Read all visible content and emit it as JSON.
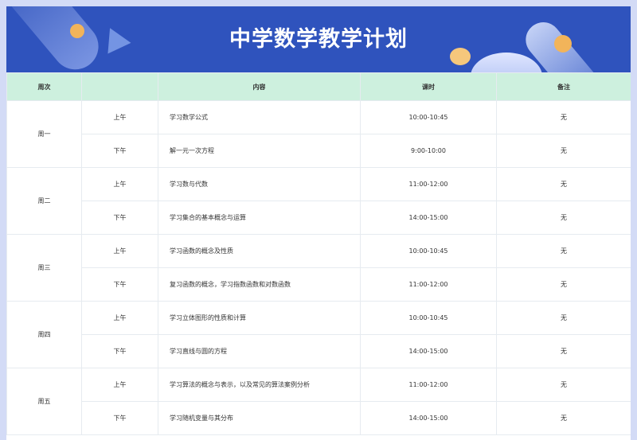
{
  "title": "中学数学教学计划",
  "colors": {
    "header_bg": "#2f53bd",
    "table_header_bg": "#cdf0de",
    "accent_orange": "#f2b45a",
    "page_bg": "#d3dbf6"
  },
  "table": {
    "headers": {
      "day": "周次",
      "period": "",
      "content": "内容",
      "time": "课时",
      "note": "备注"
    },
    "days": [
      {
        "day": "周一",
        "rows": [
          {
            "period": "上午",
            "content": "学习数学公式",
            "time": "10:00-10:45",
            "note": "无"
          },
          {
            "period": "下午",
            "content": "解一元一次方程",
            "time": "9:00-10:00",
            "note": "无"
          }
        ]
      },
      {
        "day": "周二",
        "rows": [
          {
            "period": "上午",
            "content": "学习数与代数",
            "time": "11:00-12:00",
            "note": "无"
          },
          {
            "period": "下午",
            "content": "学习集合的基本概念与运算",
            "time": "14:00-15:00",
            "note": "无"
          }
        ]
      },
      {
        "day": "周三",
        "rows": [
          {
            "period": "上午",
            "content": "学习函数的概念及性质",
            "time": "10:00-10:45",
            "note": "无"
          },
          {
            "period": "下午",
            "content": "复习函数的概念，学习指数函数和对数函数",
            "time": "11:00-12:00",
            "note": "无"
          }
        ]
      },
      {
        "day": "周四",
        "rows": [
          {
            "period": "上午",
            "content": "学习立体图形的性质和计算",
            "time": "10:00-10:45",
            "note": "无"
          },
          {
            "period": "下午",
            "content": "学习直线与圆的方程",
            "time": "14:00-15:00",
            "note": "无"
          }
        ]
      },
      {
        "day": "周五",
        "rows": [
          {
            "period": "上午",
            "content": "学习算法的概念与表示，以及常见的算法案例分析",
            "time": "11:00-12:00",
            "note": "无"
          },
          {
            "period": "下午",
            "content": "学习随机变量与其分布",
            "time": "14:00-15:00",
            "note": "无"
          }
        ]
      }
    ]
  }
}
